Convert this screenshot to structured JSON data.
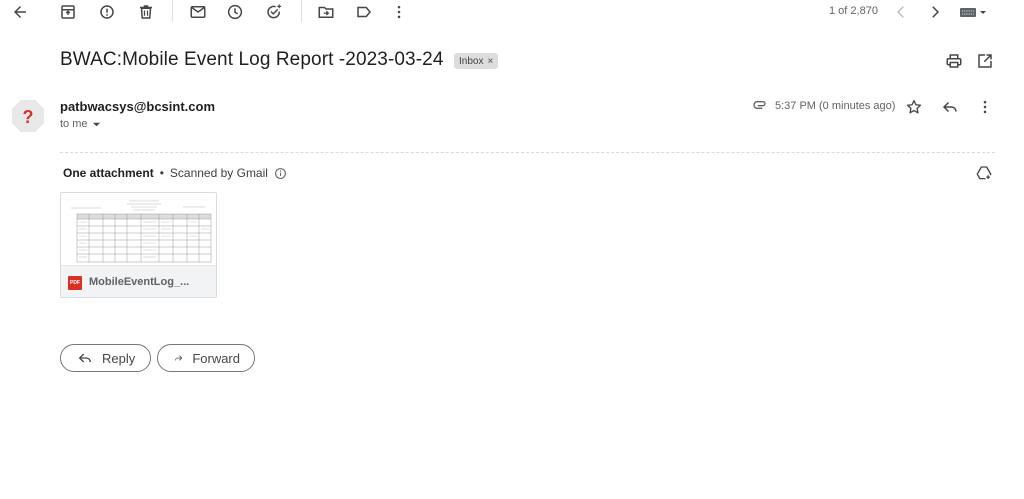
{
  "toolbar": {
    "icons": [
      "back-arrow-icon",
      "archive-icon",
      "report-spam-icon",
      "delete-icon",
      "mark-unread-icon",
      "snooze-icon",
      "add-to-tasks-icon",
      "move-to-icon",
      "label-icon",
      "more-vert-icon"
    ],
    "pager_text": "1 of 2,870"
  },
  "message": {
    "subject": "BWAC:Mobile Event Log Report -2023-03-24",
    "label_badge": "Inbox",
    "label_badge_close": "×",
    "sender_email": "patbwacsys@bcsint.com",
    "recipient_text": "to me",
    "timestamp": "5:37 PM (0 minutes ago)"
  },
  "attachments": {
    "count_text": "One attachment",
    "separator": "•",
    "scan_text": "Scanned by Gmail",
    "files": [
      {
        "name": "MobileEventLog_...",
        "type_label": "PDF"
      }
    ]
  },
  "actions": {
    "reply_label": "Reply",
    "forward_label": "Forward"
  },
  "colors": {
    "pdf_red": "#d93025",
    "avatar_bg": "#e8e8e8",
    "avatar_question": "#d93025"
  }
}
